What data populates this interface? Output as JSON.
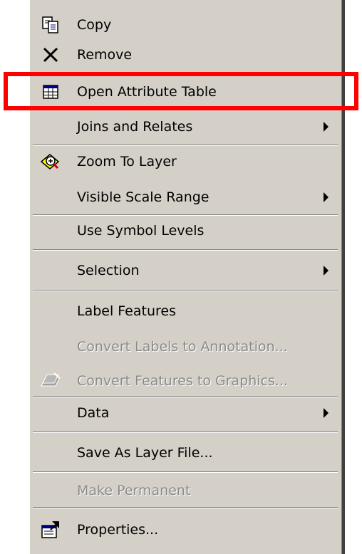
{
  "context_menu": {
    "items": {
      "copy": {
        "label": "Copy",
        "icon": "copy-icon"
      },
      "remove": {
        "label": "Remove",
        "icon": "remove-x-icon"
      },
      "open_attribute_table": {
        "label": "Open Attribute Table",
        "icon": "table-icon"
      },
      "joins_and_relates": {
        "label": "Joins and Relates",
        "submenu": true
      },
      "zoom_to_layer": {
        "label": "Zoom To Layer",
        "icon": "zoom-to-layer-icon"
      },
      "visible_scale_range": {
        "label": "Visible Scale Range",
        "submenu": true
      },
      "use_symbol_levels": {
        "label": "Use Symbol Levels"
      },
      "selection": {
        "label": "Selection",
        "submenu": true
      },
      "label_features": {
        "label": "Label Features"
      },
      "convert_labels": {
        "label": "Convert Labels to Annotation...",
        "disabled": true
      },
      "convert_features": {
        "label": "Convert Features to Graphics...",
        "disabled": true,
        "icon": "convert-graphics-icon"
      },
      "data": {
        "label": "Data",
        "submenu": true
      },
      "save_as_layer_file": {
        "label": "Save As Layer File..."
      },
      "make_permanent": {
        "label": "Make Permanent",
        "disabled": true
      },
      "properties": {
        "label": "Properties...",
        "icon": "properties-icon"
      }
    }
  },
  "colors": {
    "menu_background": "#d4d0c8",
    "highlight_border": "#ff0000",
    "disabled_text": "#8a8a8a"
  }
}
